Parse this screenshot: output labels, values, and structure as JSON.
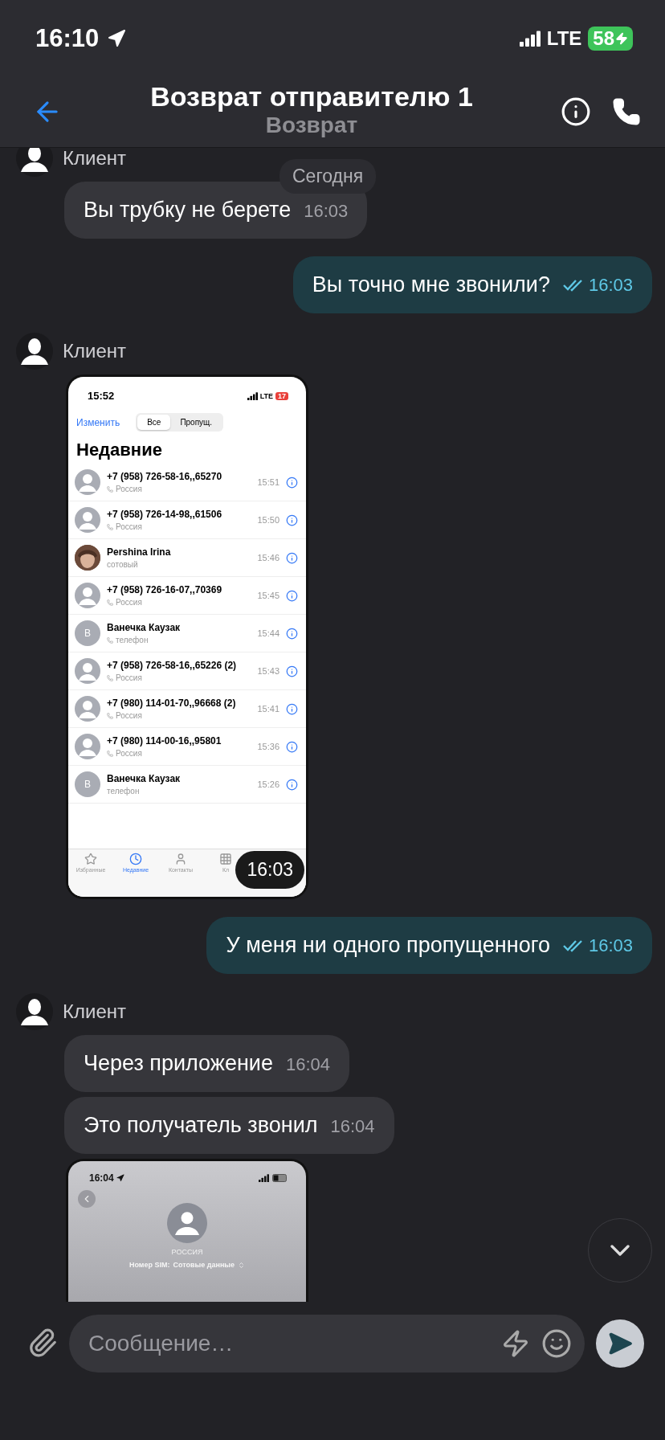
{
  "status_bar": {
    "time": "16:10",
    "network": "LTE",
    "battery": "58",
    "charging": true
  },
  "header": {
    "title": "Возврат отправителю 1",
    "subtitle": "Возврат"
  },
  "date_pill": "Сегодня",
  "messages": [
    {
      "kind": "sender",
      "name": "Клиент"
    },
    {
      "kind": "text",
      "outgoing": false,
      "text": "Вы трубку не берете",
      "time": "16:03"
    },
    {
      "kind": "text",
      "outgoing": true,
      "read": true,
      "text": "Вы точно мне звонили?",
      "time": "16:03"
    },
    {
      "kind": "sender",
      "name": "Клиент"
    },
    {
      "kind": "calls_screenshot",
      "time_badge": "16:03",
      "shot": {
        "time": "15:52",
        "network": "LTE",
        "battery": "17",
        "edit": "Изменить",
        "segments": [
          {
            "label": "Все",
            "selected": true
          },
          {
            "label": "Пропущ.",
            "selected": false
          }
        ],
        "title": "Недавние",
        "calls": [
          {
            "kind": "placeholder",
            "name": "+7 (958) 726-58-16,,65270",
            "sub": "Россия",
            "phone_icon": true,
            "time": "15:51"
          },
          {
            "kind": "placeholder",
            "name": "+7 (958) 726-14-98,,61506",
            "sub": "Россия",
            "phone_icon": true,
            "time": "15:50"
          },
          {
            "name": "Pershina Irina",
            "sub": "сотовый",
            "phone_icon": false,
            "time": "15:46"
          },
          {
            "kind": "placeholder",
            "name": "+7 (958) 726-16-07,,70369",
            "sub": "Россия",
            "phone_icon": true,
            "time": "15:45"
          },
          {
            "kind": "initial",
            "initial": "В",
            "name": "Ванечка Каузак",
            "sub": "телефон",
            "phone_icon": true,
            "time": "15:44"
          },
          {
            "kind": "placeholder",
            "name": "+7 (958) 726-58-16,,65226 (2)",
            "sub": "Россия",
            "phone_icon": true,
            "time": "15:43"
          },
          {
            "kind": "placeholder",
            "name": "+7 (980) 114-01-70,,96668 (2)",
            "sub": "Россия",
            "phone_icon": true,
            "time": "15:41"
          },
          {
            "kind": "placeholder",
            "name": "+7 (980) 114-00-16,,95801",
            "sub": "Россия",
            "phone_icon": true,
            "time": "15:36"
          },
          {
            "kind": "initial",
            "initial": "В",
            "name": "Ванечка Каузак",
            "sub": "телефон",
            "phone_icon": false,
            "time": "15:26"
          }
        ],
        "tabs": [
          {
            "label": "Избранные",
            "selected": false
          },
          {
            "label": "Недавние",
            "selected": true
          },
          {
            "label": "Контакты",
            "selected": false
          },
          {
            "label": "Кл",
            "selected": false
          }
        ]
      }
    },
    {
      "kind": "text",
      "outgoing": true,
      "read": true,
      "text": "У меня ни одного пропущенного",
      "time": "16:03"
    },
    {
      "kind": "sender",
      "name": "Клиент"
    },
    {
      "kind": "text",
      "outgoing": false,
      "text": "Через приложение",
      "time": "16:04"
    },
    {
      "kind": "text",
      "outgoing": false,
      "text": "Это получатель звонил",
      "time": "16:04"
    },
    {
      "kind": "contact_screenshot",
      "shot": {
        "time": "16:04",
        "country": "РОССИЯ",
        "sim_label": "Номер SIM:",
        "sim_value": "Сотовые данные"
      }
    }
  ],
  "composer": {
    "placeholder": "Сообщение…"
  }
}
